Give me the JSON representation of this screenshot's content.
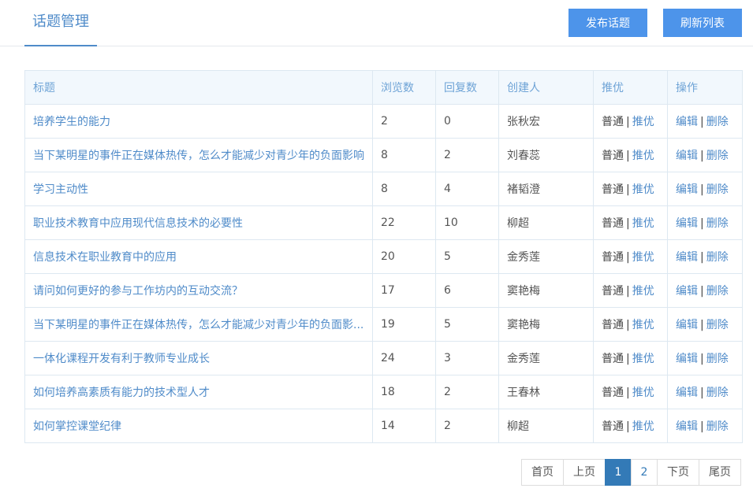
{
  "header": {
    "title": "话题管理",
    "publish_label": "发布话题",
    "refresh_label": "刷新列表"
  },
  "table": {
    "columns": [
      "标题",
      "浏览数",
      "回复数",
      "创建人",
      "推优",
      "操作"
    ],
    "rows": [
      {
        "title": "培养学生的能力",
        "views": "2",
        "replies": "0",
        "author": "张秋宏"
      },
      {
        "title": "当下某明星的事件正在媒体热传，怎么才能减少对青少年的负面影响",
        "views": "8",
        "replies": "2",
        "author": "刘春蕊"
      },
      {
        "title": "学习主动性",
        "views": "8",
        "replies": "4",
        "author": "褚韬澄"
      },
      {
        "title": "职业技术教育中应用现代信息技术的必要性",
        "views": "22",
        "replies": "10",
        "author": "柳超"
      },
      {
        "title": "信息技术在职业教育中的应用",
        "views": "20",
        "replies": "5",
        "author": "金秀莲"
      },
      {
        "title": "请问如何更好的参与工作坊内的互动交流？",
        "views": "17",
        "replies": "6",
        "author": "窦艳梅"
      },
      {
        "title": "当下某明星的事件正在媒体热传，怎么才能减少对青少年的负面影...",
        "views": "19",
        "replies": "5",
        "author": "窦艳梅"
      },
      {
        "title": "一体化课程开发有利于教师专业成长",
        "views": "24",
        "replies": "3",
        "author": "金秀莲"
      },
      {
        "title": "如何培养高素质有能力的技术型人才",
        "views": "18",
        "replies": "2",
        "author": "王春林"
      },
      {
        "title": "如何掌控课堂纪律",
        "views": "14",
        "replies": "2",
        "author": "柳超"
      }
    ],
    "promote": {
      "normal": "普通",
      "separator": "|",
      "promote": "推优"
    },
    "ops": {
      "edit": "编辑",
      "separator": "|",
      "delete": "删除"
    }
  },
  "pager": {
    "first": "首页",
    "prev": "上页",
    "pages": [
      "1",
      "2"
    ],
    "current_page": "1",
    "next": "下页",
    "last": "尾页"
  }
}
